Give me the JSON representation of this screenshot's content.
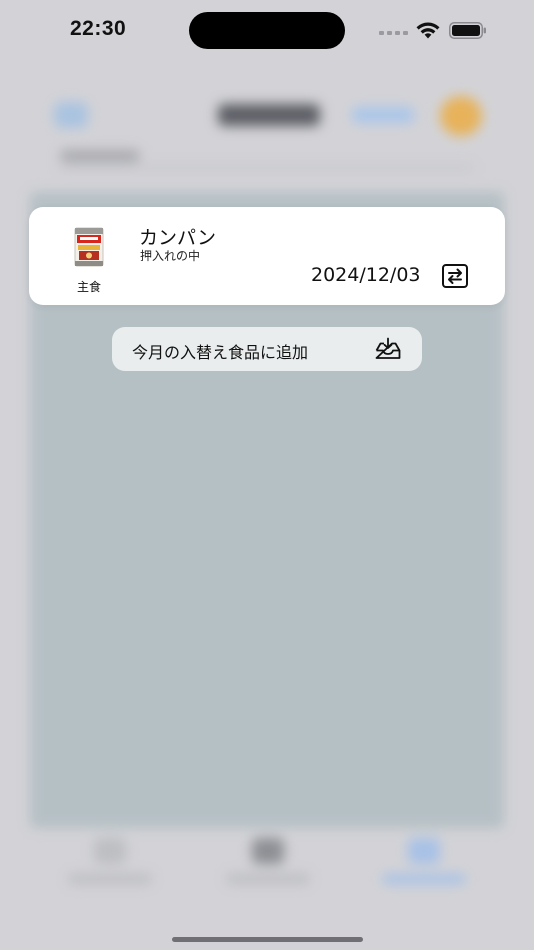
{
  "status_bar": {
    "time": "22:30"
  },
  "food_card": {
    "name": "カンパン",
    "location": "押入れの中",
    "category": "主食",
    "date": "2024/12/03",
    "swap_icon": "swap-arrows-icon",
    "thumbnail": "kanpan-can"
  },
  "actions": {
    "add_to_monthly_label": "今月の入替え食品に追加",
    "add_icon": "tray-download-icon"
  },
  "colors": {
    "card_background": "#ffffff",
    "action_background": "#e9eded",
    "backdrop": "#d3d3d7",
    "blurred_panel": "#b5c0c5"
  }
}
